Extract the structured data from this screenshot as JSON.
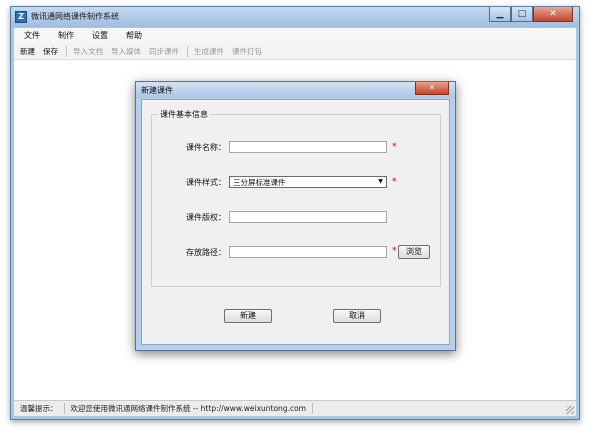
{
  "app": {
    "title": "微讯通网络课件制作系统",
    "icon_glyph": "Z",
    "window_buttons": {
      "minimize": "▁",
      "maximize": "□",
      "close": "✕"
    }
  },
  "menu": [
    "文件",
    "制作",
    "设置",
    "帮助"
  ],
  "toolbar": {
    "new": "新建",
    "save": "保存",
    "import_doc": "导入文档",
    "import_media": "导入媒体",
    "sync": "同步课件",
    "generate": "生成课件",
    "package": "课件打包"
  },
  "dialog": {
    "title": "新建课件",
    "close_glyph": "✕",
    "group_title": "课件基本信息",
    "fields": {
      "name": {
        "label": "课件名称：",
        "value": "",
        "required": "*"
      },
      "style": {
        "label": "课件样式：",
        "value": "三分屏标准课件",
        "arrow": "▼",
        "required": "*"
      },
      "copyright": {
        "label": "课件版权：",
        "value": ""
      },
      "path": {
        "label": "存放路径：",
        "value": "",
        "required": "*",
        "browse": "浏览"
      }
    },
    "ok": "新建",
    "cancel": "取消"
  },
  "status": {
    "label": "温馨提示：",
    "message": "欢迎您使用微讯通网络课件制作系统 -- http://www.weixuntong.com"
  }
}
